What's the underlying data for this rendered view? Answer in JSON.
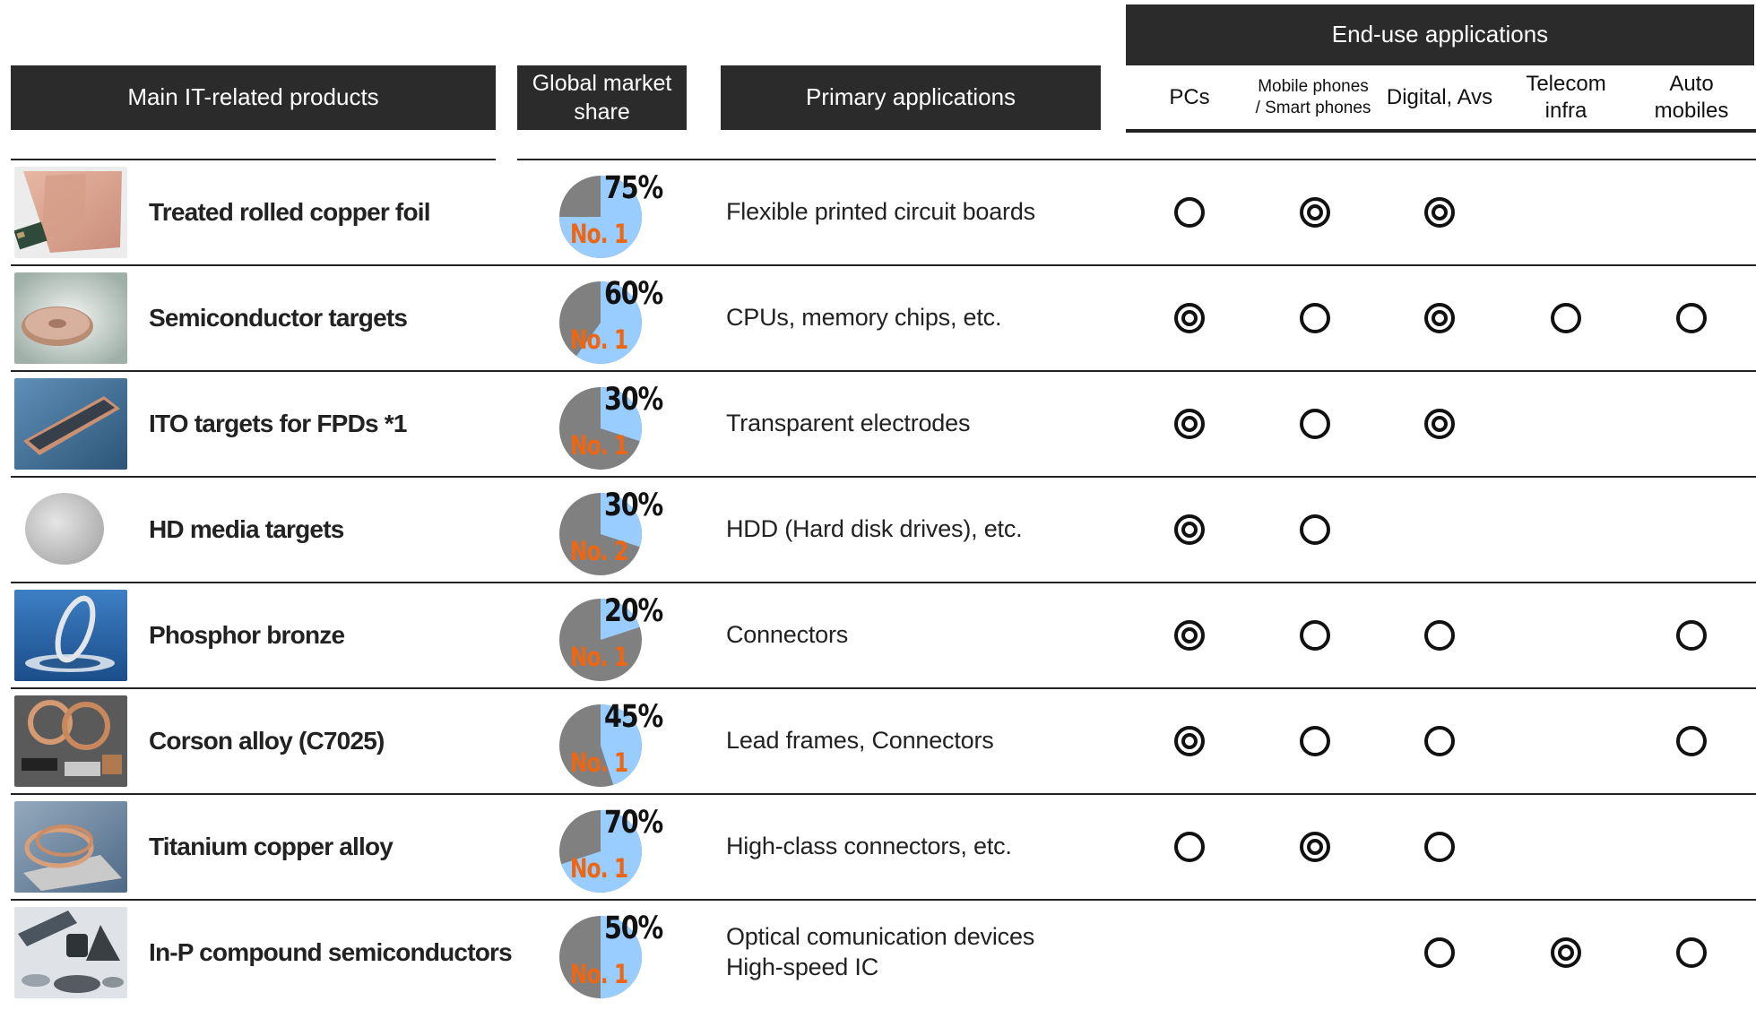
{
  "headers": {
    "products": "Main IT-related products",
    "share_line1": "Global market",
    "share_line2": "share",
    "applications": "Primary applications",
    "end_use": "End-use applications"
  },
  "end_use_columns": [
    {
      "lines": [
        "PCs"
      ]
    },
    {
      "lines": [
        "Mobile phones",
        "/ Smart phones"
      ]
    },
    {
      "lines": [
        "Digital, Avs"
      ]
    },
    {
      "lines": [
        "Telecom",
        "infra"
      ]
    },
    {
      "lines": [
        "Auto",
        "mobiles"
      ]
    }
  ],
  "legend_symbols": {
    "single": "○",
    "double": "◎"
  },
  "rows": [
    {
      "product": "Treated rolled copper foil",
      "icon": "copper-foil-photo",
      "share": "75%",
      "share_value": 75,
      "rank": "No. 1",
      "applications": [
        "Flexible printed circuit boards"
      ],
      "marks": [
        "single",
        "double",
        "double",
        "",
        ""
      ]
    },
    {
      "product": "Semiconductor targets",
      "icon": "semiconductor-target-photo",
      "share": "60%",
      "share_value": 60,
      "rank": "No. 1",
      "applications": [
        "CPUs, memory chips, etc."
      ],
      "marks": [
        "double",
        "single",
        "double",
        "single",
        "single"
      ]
    },
    {
      "product": "ITO targets for FPDs *1",
      "icon": "ito-target-photo",
      "share": "30%",
      "share_value": 30,
      "rank": "No. 1",
      "applications": [
        "Transparent electrodes"
      ],
      "marks": [
        "double",
        "single",
        "double",
        "",
        ""
      ]
    },
    {
      "product": "HD media targets",
      "icon": "hd-media-target-photo",
      "share": "30%",
      "share_value": 30,
      "rank": "No. 2",
      "applications": [
        "HDD (Hard disk drives), etc."
      ],
      "marks": [
        "double",
        "single",
        "",
        "",
        ""
      ]
    },
    {
      "product": "Phosphor bronze",
      "icon": "phosphor-bronze-photo",
      "share": "20%",
      "share_value": 20,
      "rank": "No. 1",
      "applications": [
        "Connectors"
      ],
      "marks": [
        "double",
        "single",
        "single",
        "",
        "single"
      ]
    },
    {
      "product": "Corson alloy (C7025)",
      "icon": "corson-alloy-photo",
      "share": "45%",
      "share_value": 45,
      "rank": "No. 1",
      "applications": [
        "Lead frames, Connectors"
      ],
      "marks": [
        "double",
        "single",
        "single",
        "",
        "single"
      ]
    },
    {
      "product": "Titanium copper alloy",
      "icon": "titanium-copper-photo",
      "share": "70%",
      "share_value": 70,
      "rank": "No. 1",
      "applications": [
        "High-class connectors, etc."
      ],
      "marks": [
        "single",
        "double",
        "single",
        "",
        ""
      ]
    },
    {
      "product": "In-P compound semiconductors",
      "icon": "inp-semiconductor-photo",
      "share": "50%",
      "share_value": 50,
      "rank": "No. 1",
      "applications": [
        "Optical comunication devices",
        "High-speed IC"
      ],
      "marks": [
        "",
        "",
        "single",
        "double",
        "single"
      ]
    }
  ],
  "colors": {
    "header_bg": "#2b2b2b",
    "header_text": "#ffffff",
    "pie_share": "#99ccff",
    "pie_rest": "#808080",
    "rank_text": "#ee6611"
  }
}
